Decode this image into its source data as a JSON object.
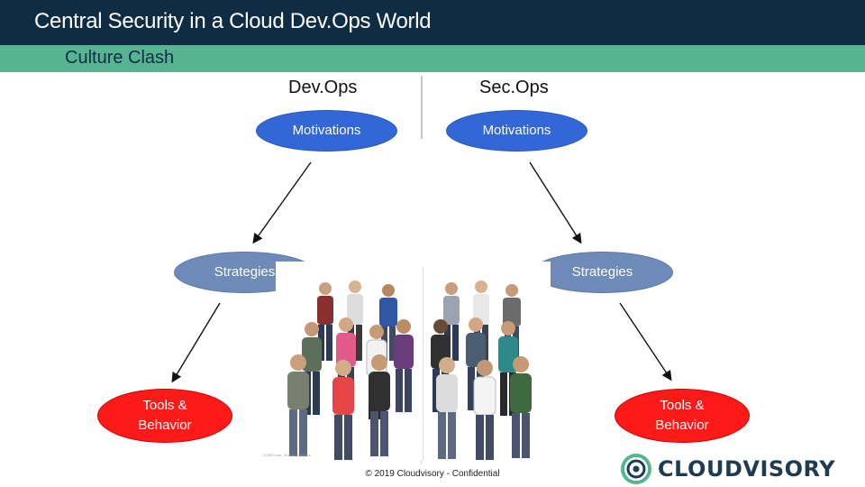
{
  "slide": {
    "title": "Central Security in a Cloud Dev.Ops World",
    "subtitle": "Culture Clash",
    "footer": "© 2019 Cloudvisory - Confidential",
    "image_credit": "123RF.com / Ruslan Olinchuk"
  },
  "diagram": {
    "left": {
      "heading": "Dev.Ops",
      "motivations": "Motivations",
      "strategies": "Strategies",
      "tools_line1": "Tools &",
      "tools_line2": "Behavior"
    },
    "right": {
      "heading": "Sec.Ops",
      "motivations": "Motivations",
      "strategies": "Strategies",
      "tools_line1": "Tools &",
      "tools_line2": "Behavior"
    }
  },
  "logo": {
    "text": "CLOUDVISORY",
    "icon": "cloudvisory-ring-icon"
  },
  "colors": {
    "title_bar": "#0e2d45",
    "subtitle_bar": "#56b491",
    "motivations": "#3366d6",
    "strategies": "#6d8ab9",
    "tools": "#ff1a1a"
  }
}
